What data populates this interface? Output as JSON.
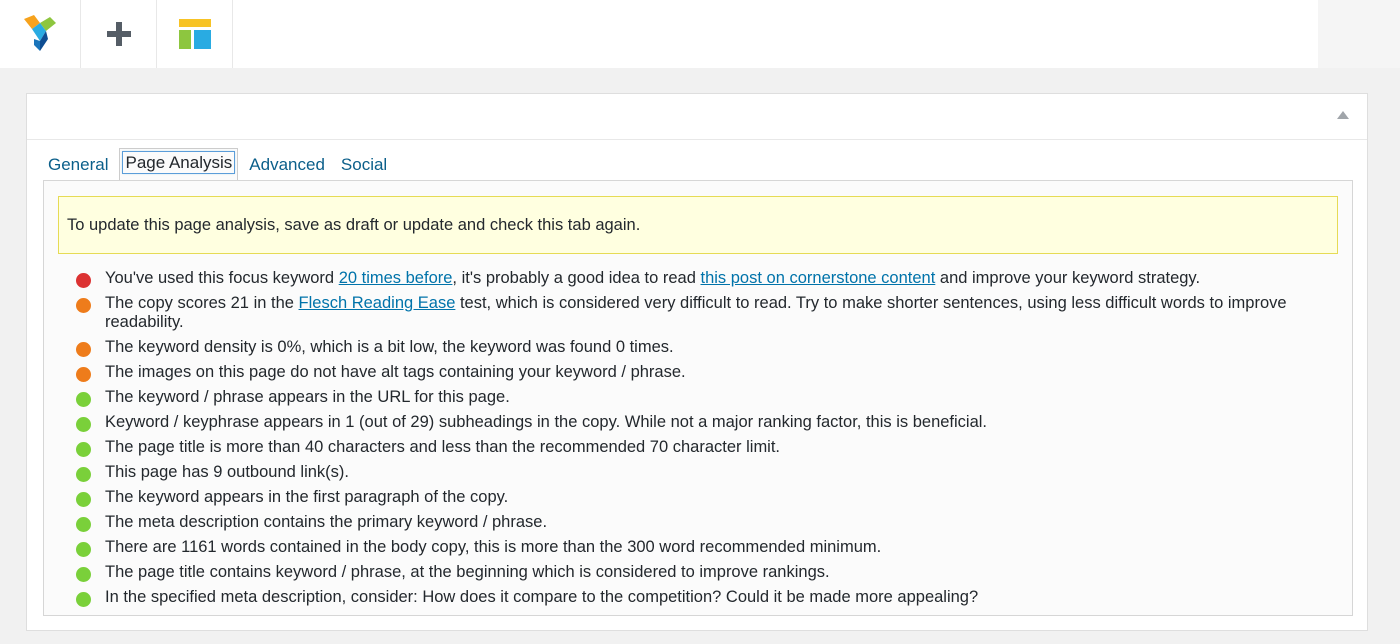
{
  "colors": {
    "bad": "#dc3232",
    "ok": "#ee7c1b",
    "good": "#7ad03a",
    "link": "#0073aa",
    "notice_bg": "#ffffe0",
    "notice_border": "#e6db55"
  },
  "toolbar": {
    "buttons": [
      {
        "icon": "visual-composer-logo-icon"
      },
      {
        "icon": "plus-icon"
      },
      {
        "icon": "layout-template-icon"
      }
    ]
  },
  "tabs": [
    {
      "label": "General"
    },
    {
      "label": "Page Analysis",
      "active": true
    },
    {
      "label": "Advanced"
    },
    {
      "label": "Social"
    }
  ],
  "notice": "To update this page analysis, save as draft or update and check this tab again.",
  "results": [
    {
      "status": "red",
      "pre": "You've used this focus keyword ",
      "link1": "20 times before",
      "mid": ", it's probably a good idea to read ",
      "link2": "this post on cornerstone content",
      "post": " and improve your keyword strategy."
    },
    {
      "status": "orange",
      "pre": "The copy scores 21 in the ",
      "link1": "Flesch Reading Ease",
      "post": " test, which is considered very difficult to read. Try to make shorter sentences, using less difficult words to improve readability."
    },
    {
      "status": "orange",
      "text": "The keyword density is 0%, which is a bit low, the keyword was found 0 times."
    },
    {
      "status": "orange",
      "text": "The images on this page do not have alt tags containing your keyword / phrase."
    },
    {
      "status": "green",
      "text": "The keyword / phrase appears in the URL for this page."
    },
    {
      "status": "green",
      "text": "Keyword / keyphrase appears in 1 (out of 29) subheadings in the copy. While not a major ranking factor, this is beneficial."
    },
    {
      "status": "green",
      "text": "The page title is more than 40 characters and less than the recommended 70 character limit."
    },
    {
      "status": "green",
      "text": "This page has 9 outbound link(s)."
    },
    {
      "status": "green",
      "text": "The keyword appears in the first paragraph of the copy."
    },
    {
      "status": "green",
      "text": "The meta description contains the primary keyword / phrase."
    },
    {
      "status": "green",
      "text": "There are 1161 words contained in the body copy, this is more than the 300 word recommended minimum."
    },
    {
      "status": "green",
      "text": "The page title contains keyword / phrase, at the beginning which is considered to improve rankings."
    },
    {
      "status": "green",
      "text": "In the specified meta description, consider: How does it compare to the competition? Could it be made more appealing?"
    }
  ]
}
